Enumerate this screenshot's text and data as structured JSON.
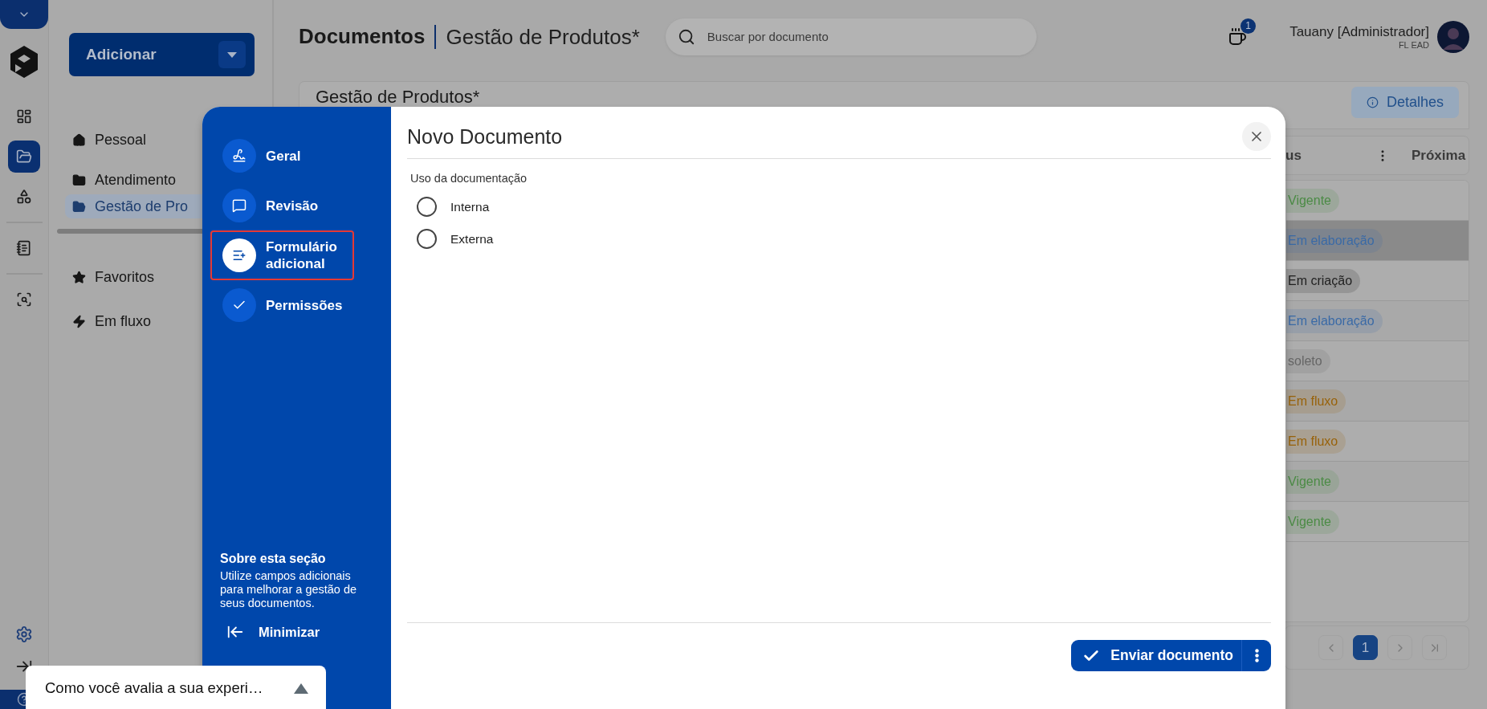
{
  "rail_items": [
    {
      "selected": false
    },
    {
      "selected": true
    },
    {
      "selected": false
    },
    {
      "selected": false
    },
    {
      "selected": false
    }
  ],
  "add_button": {
    "label": "Adicionar"
  },
  "nav": {
    "items": [
      {
        "label": "Pessoal",
        "selected": false
      },
      {
        "label": "Atendimento",
        "selected": false
      },
      {
        "label": "Gestão de Pro",
        "selected": true
      }
    ],
    "bottom_items": [
      {
        "label": "Favoritos"
      },
      {
        "label": "Em fluxo"
      }
    ]
  },
  "header": {
    "title": "Documentos",
    "subtitle": "Gestão de Produtos*",
    "search": {
      "placeholder": "Buscar por documento"
    },
    "cart_badge": "1",
    "user": {
      "name": "Tauany [Administrador]",
      "org": "FL EAD"
    }
  },
  "section": {
    "title": "Gestão de Produtos*",
    "details_button": "Detalhes"
  },
  "table": {
    "columns": [
      "us",
      "Próxima"
    ],
    "rows": [
      {
        "status": "Vigente",
        "color": "#4b8b45",
        "selected": false
      },
      {
        "status": "Em elaboração",
        "color": "#3a6aa6",
        "selected": true
      },
      {
        "status": "Em criação",
        "color": "#1f1f1f",
        "selected": false
      },
      {
        "status": "Em elaboração",
        "color": "#3a6aa6",
        "selected": false
      },
      {
        "status": "soleto",
        "color": "#666666",
        "selected": false
      },
      {
        "status": "Em fluxo",
        "color": "#98620a",
        "selected": false
      },
      {
        "status": "Em fluxo",
        "color": "#98620a",
        "selected": false
      },
      {
        "status": "Vigente",
        "color": "#4b8b45",
        "selected": false
      },
      {
        "status": "Vigente",
        "color": "#4b8b45",
        "selected": false
      }
    ]
  },
  "pagination": {
    "pages": [
      {
        "label": "1",
        "selected": true
      }
    ]
  },
  "modal": {
    "title": "Novo Documento",
    "steps": [
      {
        "label": "Geral",
        "selected": false
      },
      {
        "label": "Revisão",
        "selected": false
      },
      {
        "label": "Formulário adicional",
        "selected": true
      },
      {
        "label": "Permissões",
        "selected": false
      }
    ],
    "about": {
      "title": "Sobre esta seção",
      "text": "Utilize campos adicionais para melhorar a gestão de seus documentos."
    },
    "minimize": "Minimizar",
    "field_label": "Uso da documentação",
    "options": [
      {
        "label": "Interna",
        "selected": false
      },
      {
        "label": "Externa",
        "selected": false
      }
    ],
    "submit": "Enviar documento"
  },
  "feedback": {
    "text": "Como você avalia a sua experi…"
  }
}
